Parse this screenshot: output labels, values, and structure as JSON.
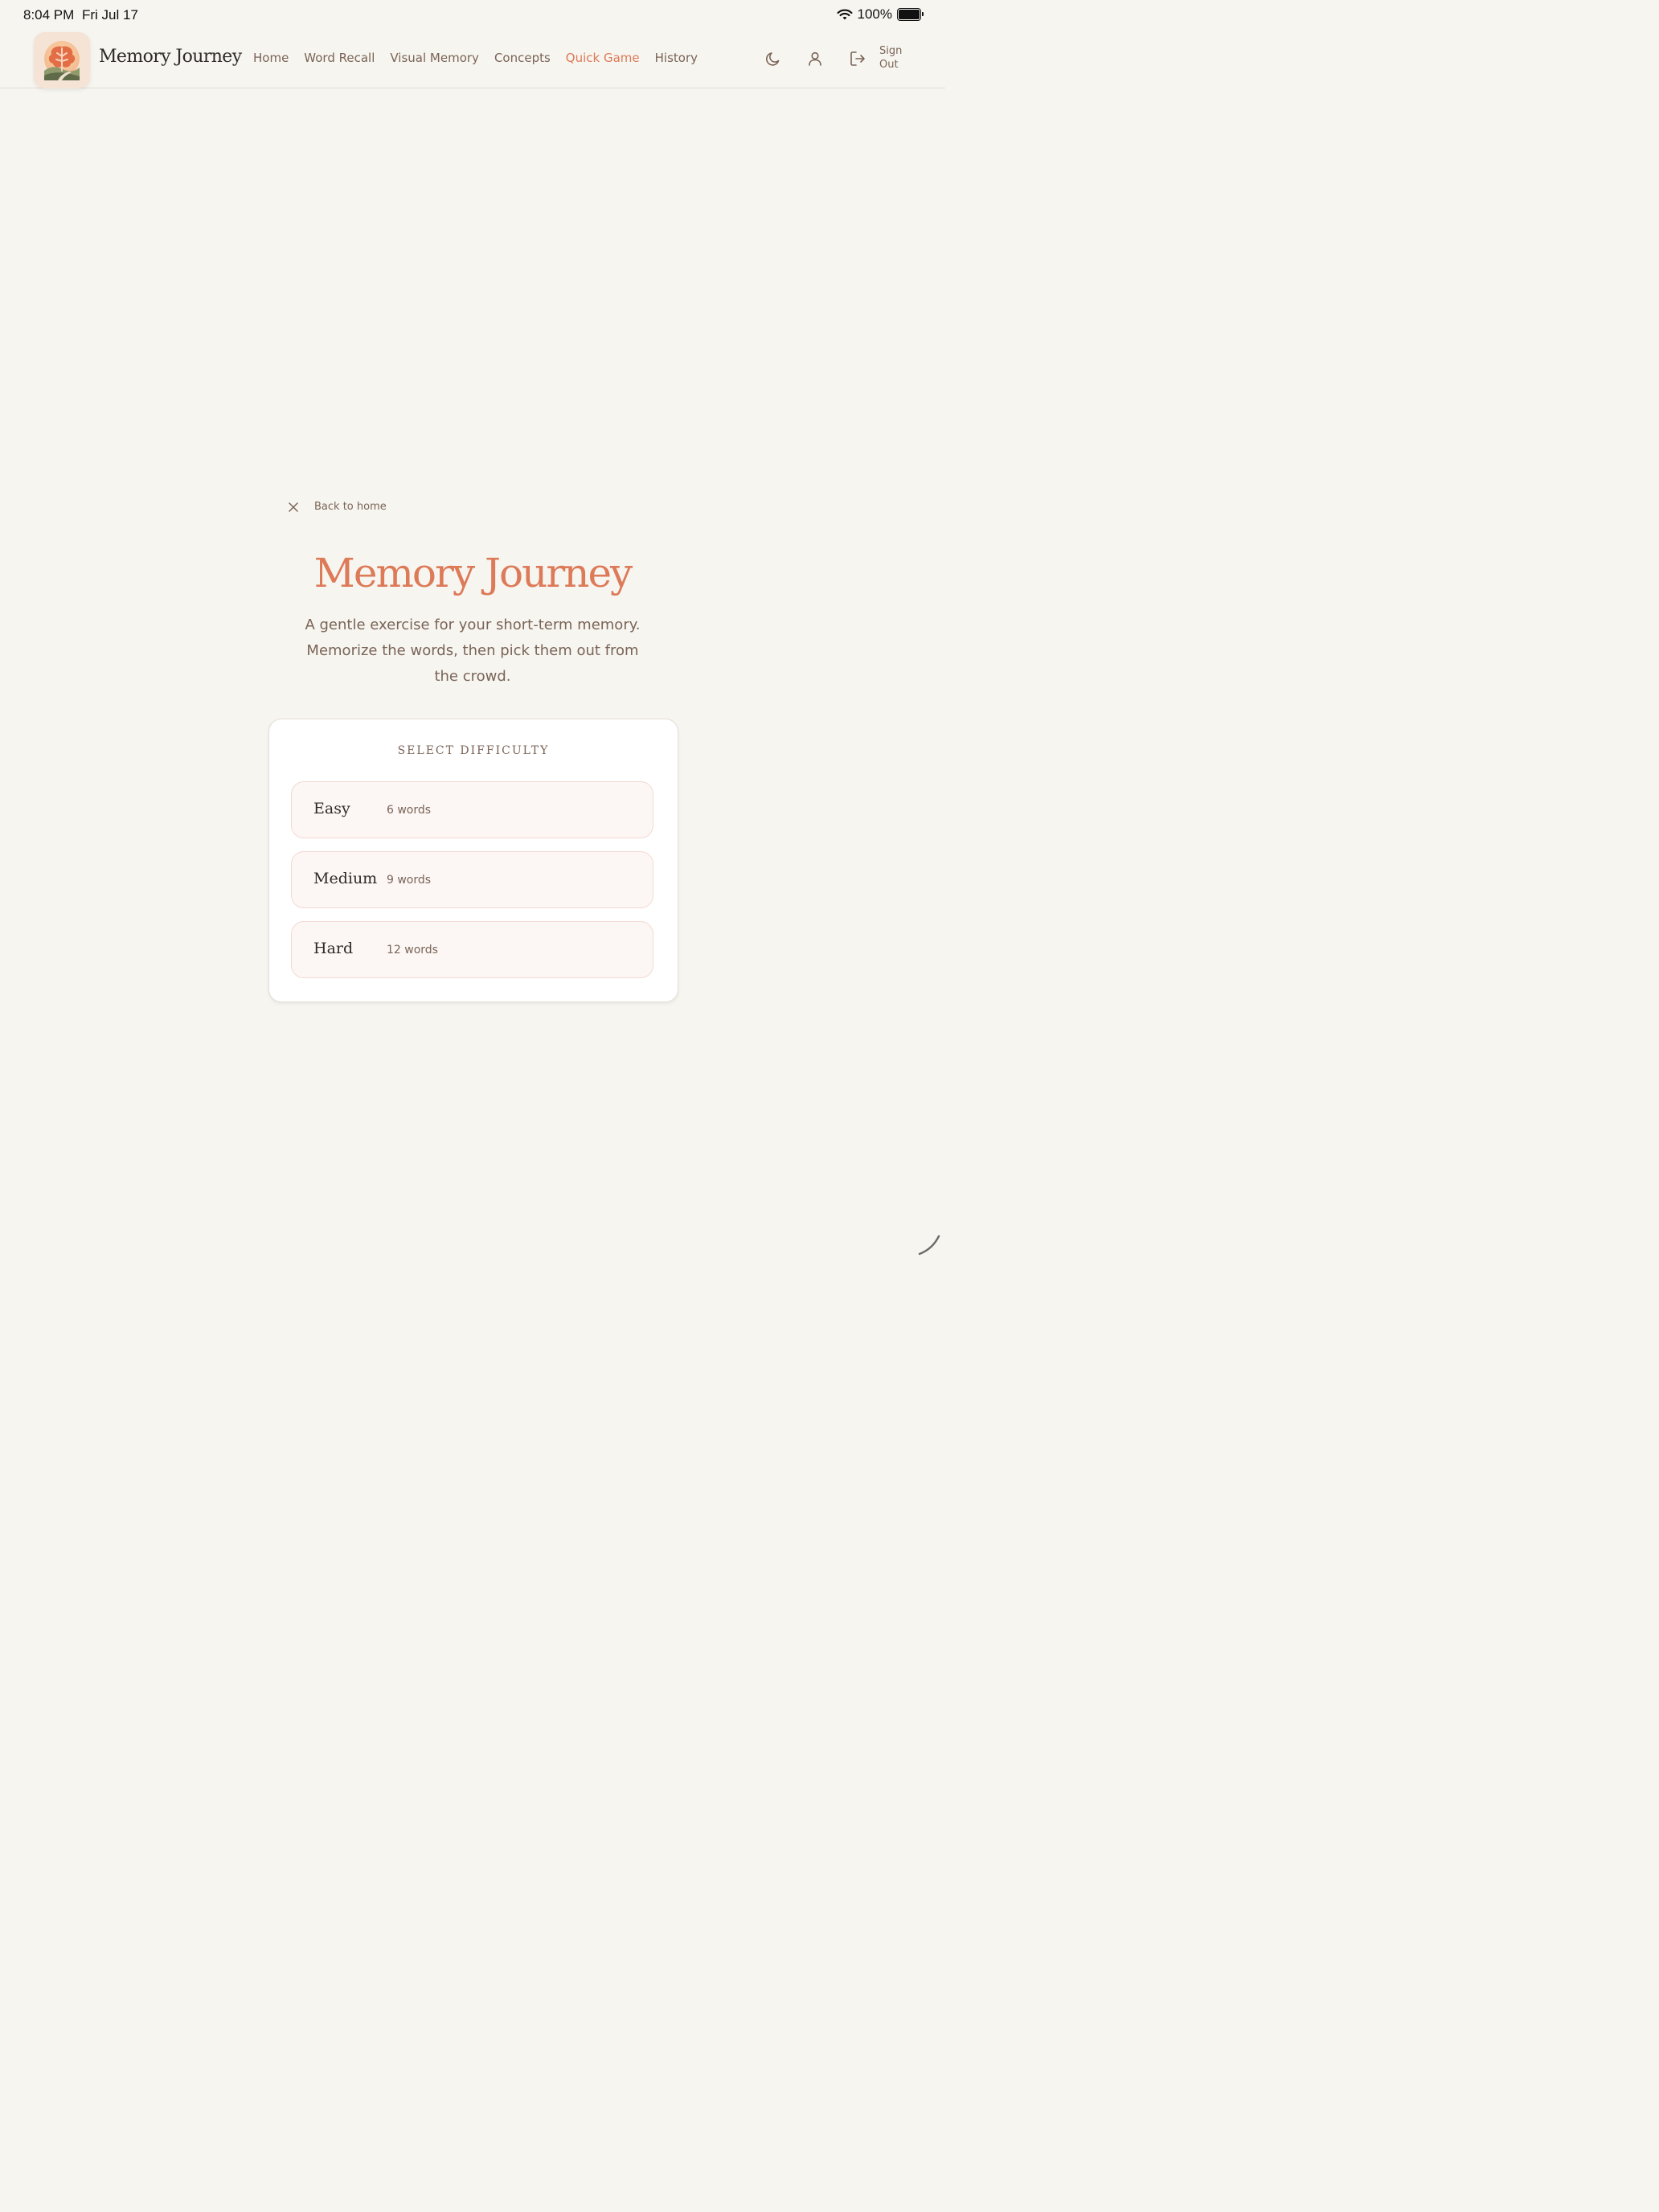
{
  "status_bar": {
    "time": "8:04 PM",
    "date": "Fri Jul 17",
    "battery": "100%"
  },
  "header": {
    "brand": "Memory Journey",
    "nav": [
      {
        "label": "Home",
        "active": false
      },
      {
        "label": "Word Recall",
        "active": false
      },
      {
        "label": "Visual Memory",
        "active": false
      },
      {
        "label": "Concepts",
        "active": false
      },
      {
        "label": "Quick Game",
        "active": true
      },
      {
        "label": "History",
        "active": false
      }
    ],
    "icons": [
      "moon-icon",
      "user-icon",
      "sign-out-icon"
    ],
    "sign_out_line1": "Sign",
    "sign_out_line2": "Out"
  },
  "main": {
    "back_label": "Back to home",
    "title": "Memory Journey",
    "subtitle": "A gentle exercise for your short-term memory. Memorize the words, then pick them out from the crowd.",
    "card_heading": "SELECT DIFFICULTY",
    "options": [
      {
        "label": "Easy",
        "count": "6 words"
      },
      {
        "label": "Medium",
        "count": "9 words"
      },
      {
        "label": "Hard",
        "count": "12 words"
      }
    ]
  },
  "colors": {
    "accent": "#dd7a58",
    "background": "#f7f5f0",
    "muted_text": "#7a6457",
    "option_border": "#f4d9d1"
  }
}
